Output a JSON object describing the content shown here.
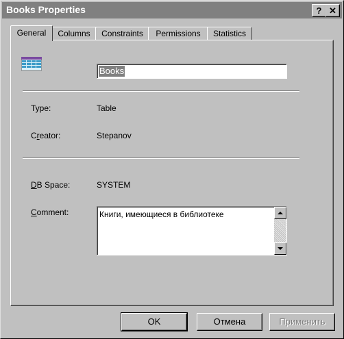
{
  "window": {
    "title": "Books Properties",
    "help_glyph": "?",
    "close_glyph": "✕"
  },
  "tabs": [
    {
      "label": "General",
      "active": true
    },
    {
      "label": "Columns",
      "active": false
    },
    {
      "label": "Constraints",
      "active": false
    },
    {
      "label": "Permissions",
      "active": false
    },
    {
      "label": "Statistics",
      "active": false
    }
  ],
  "general": {
    "icon": "table-icon",
    "name_value": "Books",
    "type_label": "Type:",
    "type_value": "Table",
    "creator_label_pre": "C",
    "creator_label_u": "r",
    "creator_label_post": "eator:",
    "creator_value": "Stepanov",
    "dbspace_label_u": "D",
    "dbspace_label_post": "B Space:",
    "dbspace_value": "SYSTEM",
    "comment_label_u": "C",
    "comment_label_post": "omment:",
    "comment_value": "Книги, имеющиеся в библиотеке"
  },
  "buttons": {
    "ok": "OK",
    "cancel": "Отмена",
    "apply": "Применить"
  },
  "colors": {
    "title_bar_inactive": "#808080",
    "face": "#c0c0c0",
    "selection": "#808080",
    "icon_accent": "#3c9cc8"
  }
}
